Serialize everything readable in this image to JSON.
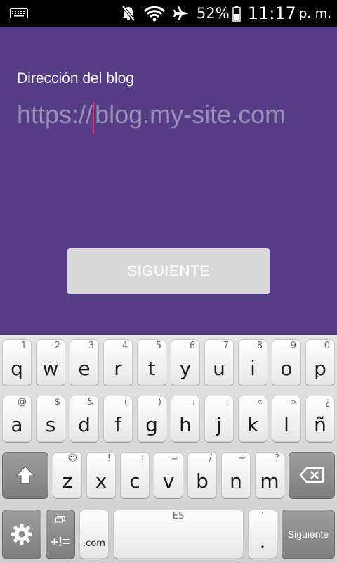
{
  "status_bar": {
    "battery_percent": "52%",
    "time": "11:17",
    "ampm": "p. m.",
    "icons": [
      "keyboard-icon",
      "mute-icon",
      "wifi-icon",
      "airplane-icon",
      "battery-icon"
    ]
  },
  "form": {
    "label": "Dirección del blog",
    "url_prefix": "https://",
    "url_placeholder": "blog.my-site.com",
    "next_button": "SIGUIENTE"
  },
  "keyboard": {
    "row1": [
      {
        "ch": "q",
        "hint": "1"
      },
      {
        "ch": "w",
        "hint": "2"
      },
      {
        "ch": "e",
        "hint": "3"
      },
      {
        "ch": "r",
        "hint": "4"
      },
      {
        "ch": "t",
        "hint": "5"
      },
      {
        "ch": "y",
        "hint": "6"
      },
      {
        "ch": "u",
        "hint": "7"
      },
      {
        "ch": "i",
        "hint": "8"
      },
      {
        "ch": "o",
        "hint": "9"
      },
      {
        "ch": "p",
        "hint": "0"
      }
    ],
    "row2": [
      {
        "ch": "a",
        "hint": "@"
      },
      {
        "ch": "s",
        "hint": "$"
      },
      {
        "ch": "d",
        "hint": "&"
      },
      {
        "ch": "f",
        "hint": "("
      },
      {
        "ch": "g",
        "hint": ")"
      },
      {
        "ch": "h",
        "hint": ":"
      },
      {
        "ch": "j",
        "hint": ";"
      },
      {
        "ch": "k",
        "hint": "«"
      },
      {
        "ch": "l",
        "hint": "»"
      },
      {
        "ch": "ñ",
        "hint": "¿"
      }
    ],
    "row3": [
      {
        "ch": "z",
        "hint": "☺"
      },
      {
        "ch": "x",
        "hint": "!"
      },
      {
        "ch": "c",
        "hint": "¡"
      },
      {
        "ch": "v",
        "hint": "="
      },
      {
        "ch": "b",
        "hint": "/"
      },
      {
        "ch": "n",
        "hint": "+"
      },
      {
        "ch": "m",
        "hint": "?"
      }
    ],
    "symbols_label": "+!=",
    "com_label": ".com",
    "space_label": "ES",
    "period_label": ".",
    "period_hint": "’",
    "enter_label": "Siguiente"
  },
  "colors": {
    "background": "#573d86",
    "cursor": "#e23368",
    "button": "#d9d9d9"
  }
}
